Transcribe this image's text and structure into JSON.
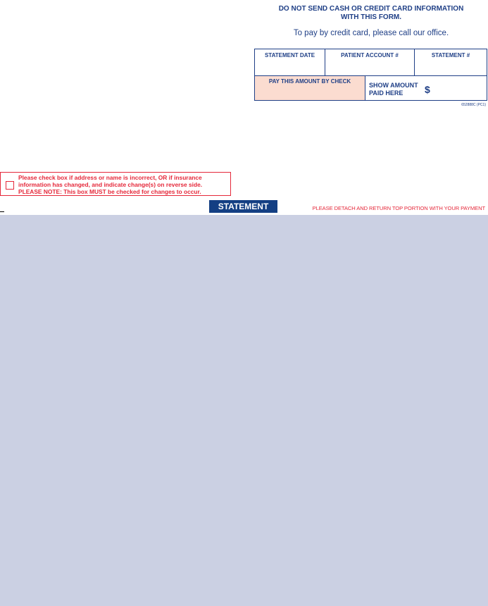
{
  "header": {
    "notice_line1": "DO NOT SEND CASH OR CREDIT CARD INFORMATION",
    "notice_line2": "WITH THIS FORM.",
    "credit_card_line": "To pay by credit card, please call our office."
  },
  "remittance_table": {
    "statement_date_label": "STATEMENT DATE",
    "patient_account_label": "PATIENT ACCOUNT #",
    "statement_number_label": "STATEMENT #",
    "pay_amount_label": "PAY THIS AMOUNT BY CHECK",
    "show_amount_line1": "SHOW AMOUNT",
    "show_amount_line2": "PAID HERE",
    "currency_symbol": "$"
  },
  "form_code": "652888C (PC1)",
  "address_change": {
    "line1": "Please check box if address or name is incorrect, OR if insurance",
    "line2": "information has changed, and indicate change(s) on reverse side.",
    "line3": "PLEASE NOTE: This box MUST be checked for changes to occur."
  },
  "statement_badge": "STATEMENT",
  "detach_instruction": "PLEASE DETACH AND RETURN TOP PORTION WITH YOUR PAYMENT",
  "colors": {
    "brand_blue": "#1f3f86",
    "alert_red": "#e5283a",
    "pay_fill": "#fbdcd0",
    "panel_fill": "#cbd0e3"
  }
}
